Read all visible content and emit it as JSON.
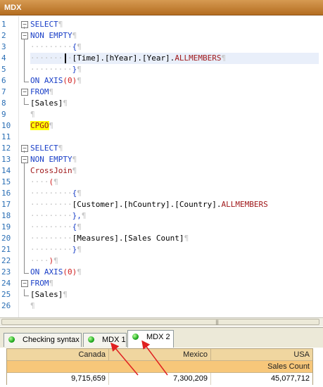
{
  "window": {
    "title": "MDX"
  },
  "editor": {
    "line_numbers": [
      "1",
      "2",
      "3",
      "4",
      "5",
      "6",
      "7",
      "8",
      "9",
      "10",
      "11",
      "12",
      "13",
      "14",
      "15",
      "16",
      "17",
      "18",
      "19",
      "20",
      "21",
      "22",
      "23",
      "24",
      "25",
      "26"
    ],
    "pilcrow": "¶",
    "lines": [
      {
        "code": "SELECT"
      },
      {
        "code": "NON EMPTY"
      },
      {
        "code": "{"
      },
      {
        "code": "[Time].[hYear].[Year].",
        "fn": "ALLMEMBERS"
      },
      {
        "code": "}"
      },
      {
        "code": "ON AXIS",
        "paren": "(0)"
      },
      {
        "code": "FROM"
      },
      {
        "code": "[Sales]"
      },
      {
        "code": ""
      },
      {
        "code": "GO"
      },
      {
        "code": ""
      },
      {
        "code": "SELECT"
      },
      {
        "code": "NON EMPTY"
      },
      {
        "code": "CrossJoin"
      },
      {
        "code": "("
      },
      {
        "code": "{"
      },
      {
        "code": "[Customer].[hCountry].[Country].",
        "fn": "ALLMEMBERS"
      },
      {
        "code": "},"
      },
      {
        "code": "{"
      },
      {
        "code": "[Measures].[Sales Count]"
      },
      {
        "code": "}"
      },
      {
        "code": ")"
      },
      {
        "code": "ON AXIS",
        "paren": "(0)"
      },
      {
        "code": "FROM"
      },
      {
        "code": "[Sales]"
      },
      {
        "code": ""
      }
    ],
    "go_prefix": "CP"
  },
  "tabs": [
    {
      "label": "Checking syntax",
      "status": "green"
    },
    {
      "label": "MDX 1",
      "status": "green"
    },
    {
      "label": "MDX 2",
      "status": "green",
      "active": true
    }
  ],
  "result_grid": {
    "columns": [
      "Canada",
      "Mexico",
      "USA"
    ],
    "measure_header": "Sales Count",
    "values": [
      "9,715,659",
      "7,300,209",
      "45,077,712"
    ]
  }
}
